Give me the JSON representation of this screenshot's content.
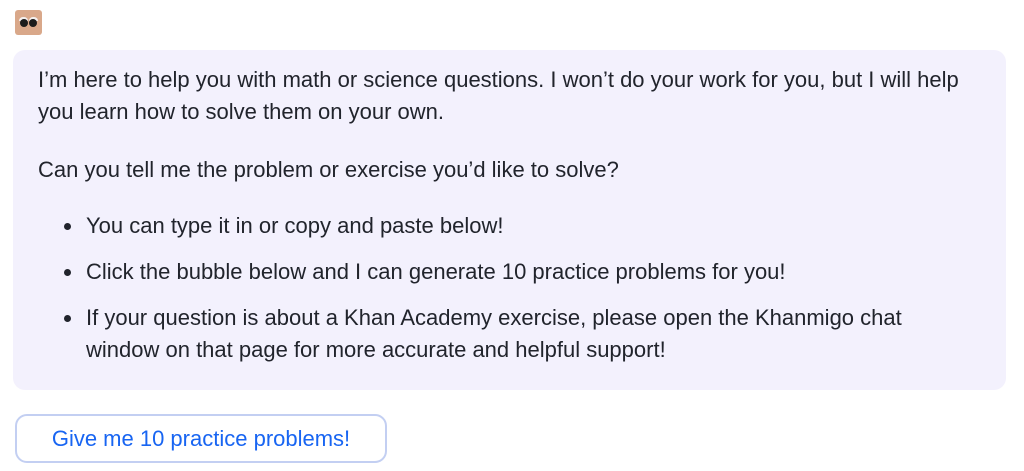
{
  "assistant": {
    "avatar_icon": "khanmigo-avatar-icon"
  },
  "message": {
    "paragraphs": [
      "I’m here to help you with math or science questions. I won’t do your work for you, but I will help you learn how to solve them on your own.",
      "Can you tell me the problem or exercise you’d like to solve?"
    ],
    "bullets": [
      "You can type it in or copy and paste below!",
      "Click the bubble below and I can generate 10 practice problems for you!",
      "If your question is about a Khan Academy exercise, please open the Khanmigo chat window on that page for more accurate and helpful support!"
    ]
  },
  "suggestion": {
    "label": "Give me 10 practice problems!"
  },
  "colors": {
    "bubble_background": "#f3f1fd",
    "button_text": "#1865f2",
    "button_border": "#c3cff2",
    "avatar": "#d9a88a"
  }
}
